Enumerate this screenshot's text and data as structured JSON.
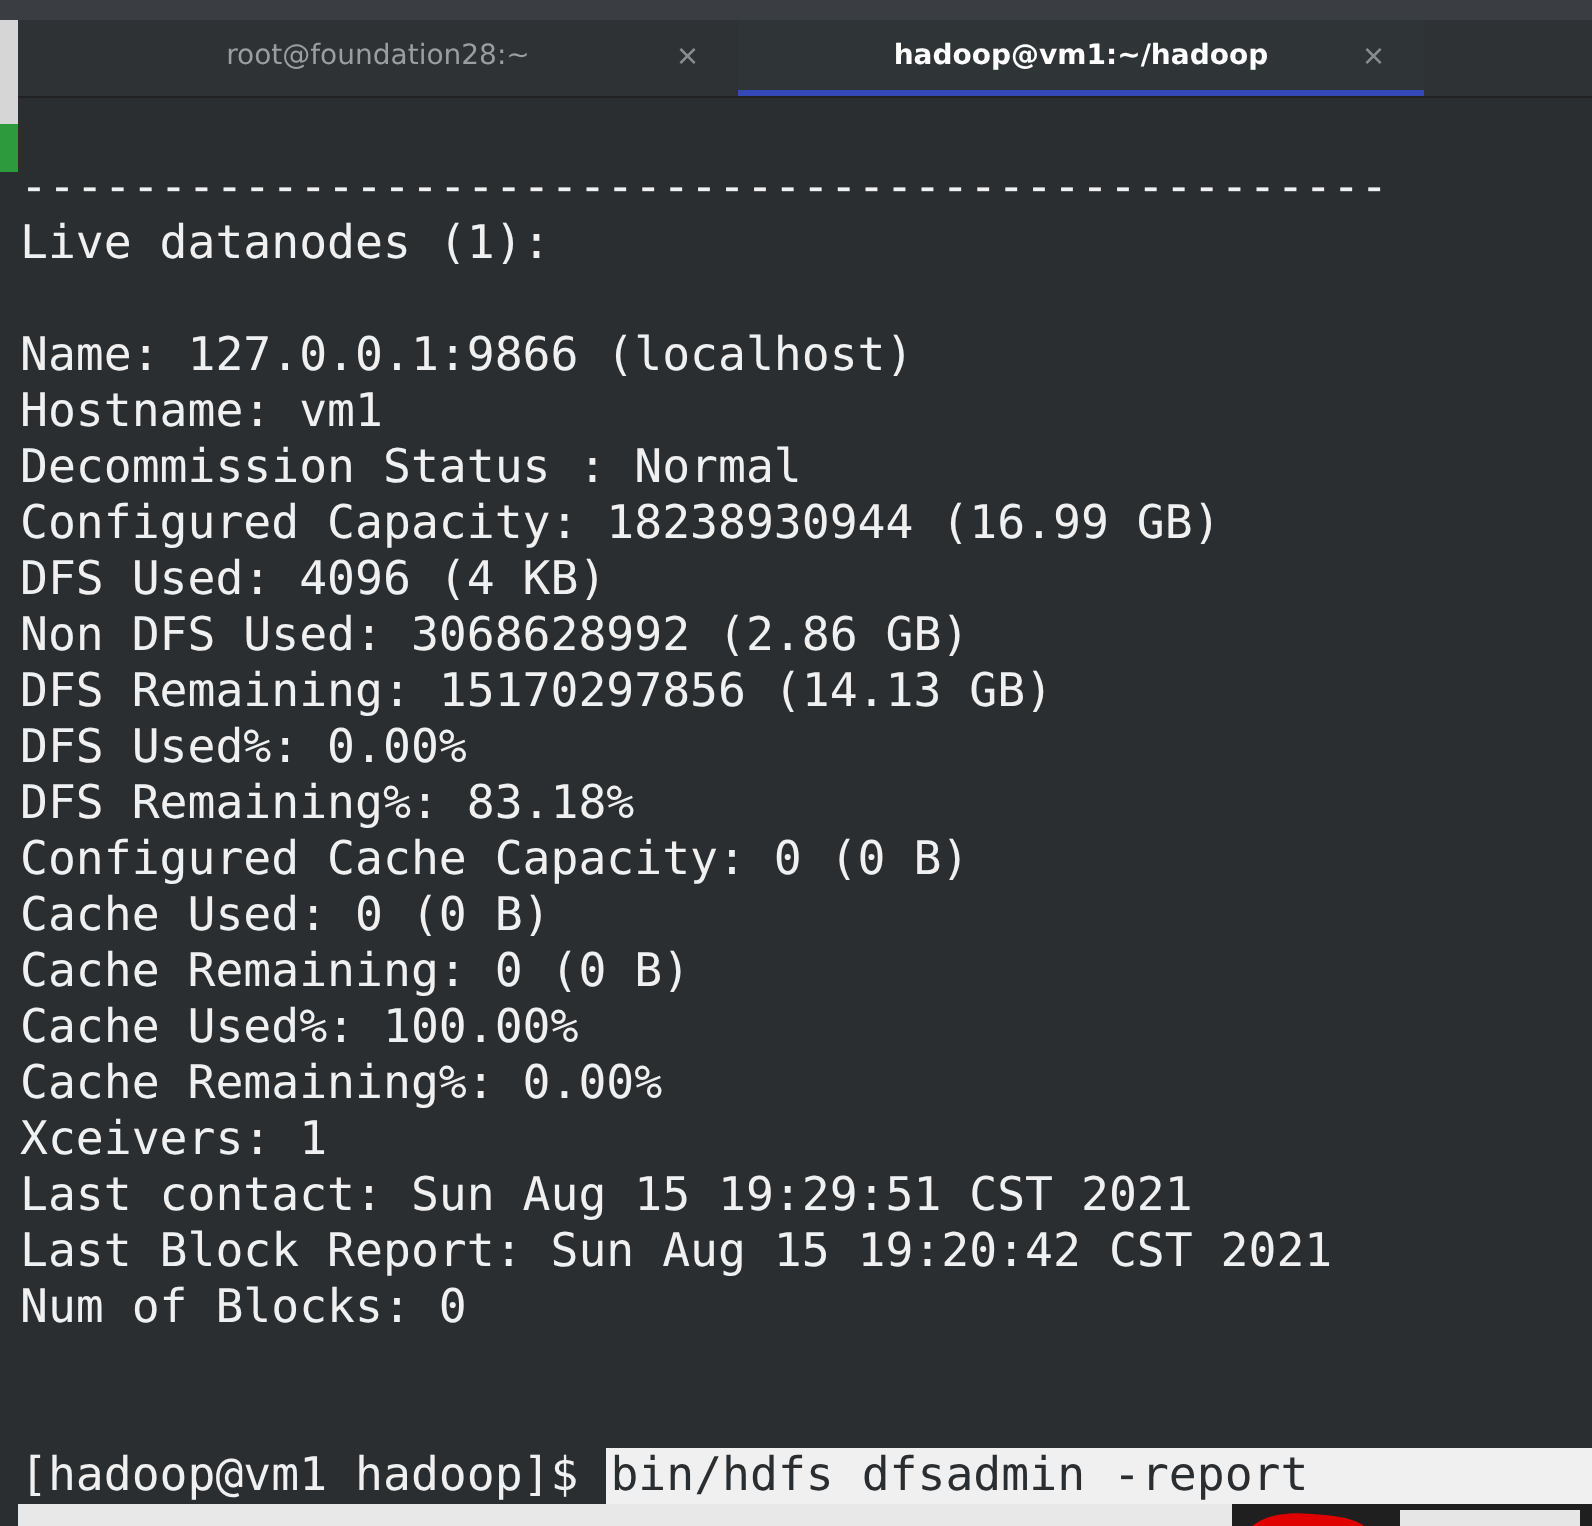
{
  "tabs": [
    {
      "label": "root@foundation28:~",
      "close": "×",
      "selected": false
    },
    {
      "label": "hadoop@vm1:~/hadoop",
      "close": "×",
      "selected": true
    }
  ],
  "terminal": {
    "output_blocks": [
      [
        "-------------------------------------------------",
        "Live datanodes (1):"
      ],
      [
        "Name: 127.0.0.1:9866 (localhost)",
        "Hostname: vm1",
        "Decommission Status : Normal",
        "Configured Capacity: 18238930944 (16.99 GB)",
        "DFS Used: 4096 (4 KB)",
        "Non DFS Used: 3068628992 (2.86 GB)",
        "DFS Remaining: 15170297856 (14.13 GB)",
        "DFS Used%: 0.00%",
        "DFS Remaining%: 83.18%",
        "Configured Cache Capacity: 0 (0 B)",
        "Cache Used: 0 (0 B)",
        "Cache Remaining: 0 (0 B)",
        "Cache Used%: 100.00%",
        "Cache Remaining%: 0.00%",
        "Xceivers: 1",
        "Last contact: Sun Aug 15 19:29:51 CST 2021",
        "Last Block Report: Sun Aug 15 19:20:42 CST 2021",
        "Num of Blocks: 0"
      ]
    ],
    "prompt": "[hadoop@vm1 hadoop]$",
    "command": {
      "text": "bin/hdfs dfsadmin -report",
      "selected": true
    }
  }
}
